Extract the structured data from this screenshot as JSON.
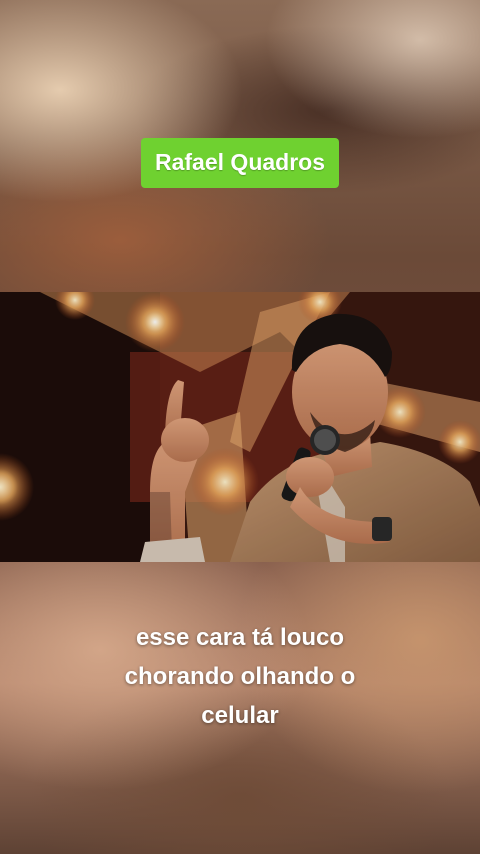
{
  "video": {
    "title_badge": "Rafael Quadros",
    "caption_lines": [
      "esse cara tá louco",
      "chorando olhando o",
      "celular"
    ]
  },
  "colors": {
    "badge_background": "#6fd130",
    "caption_text": "#ffffff"
  }
}
